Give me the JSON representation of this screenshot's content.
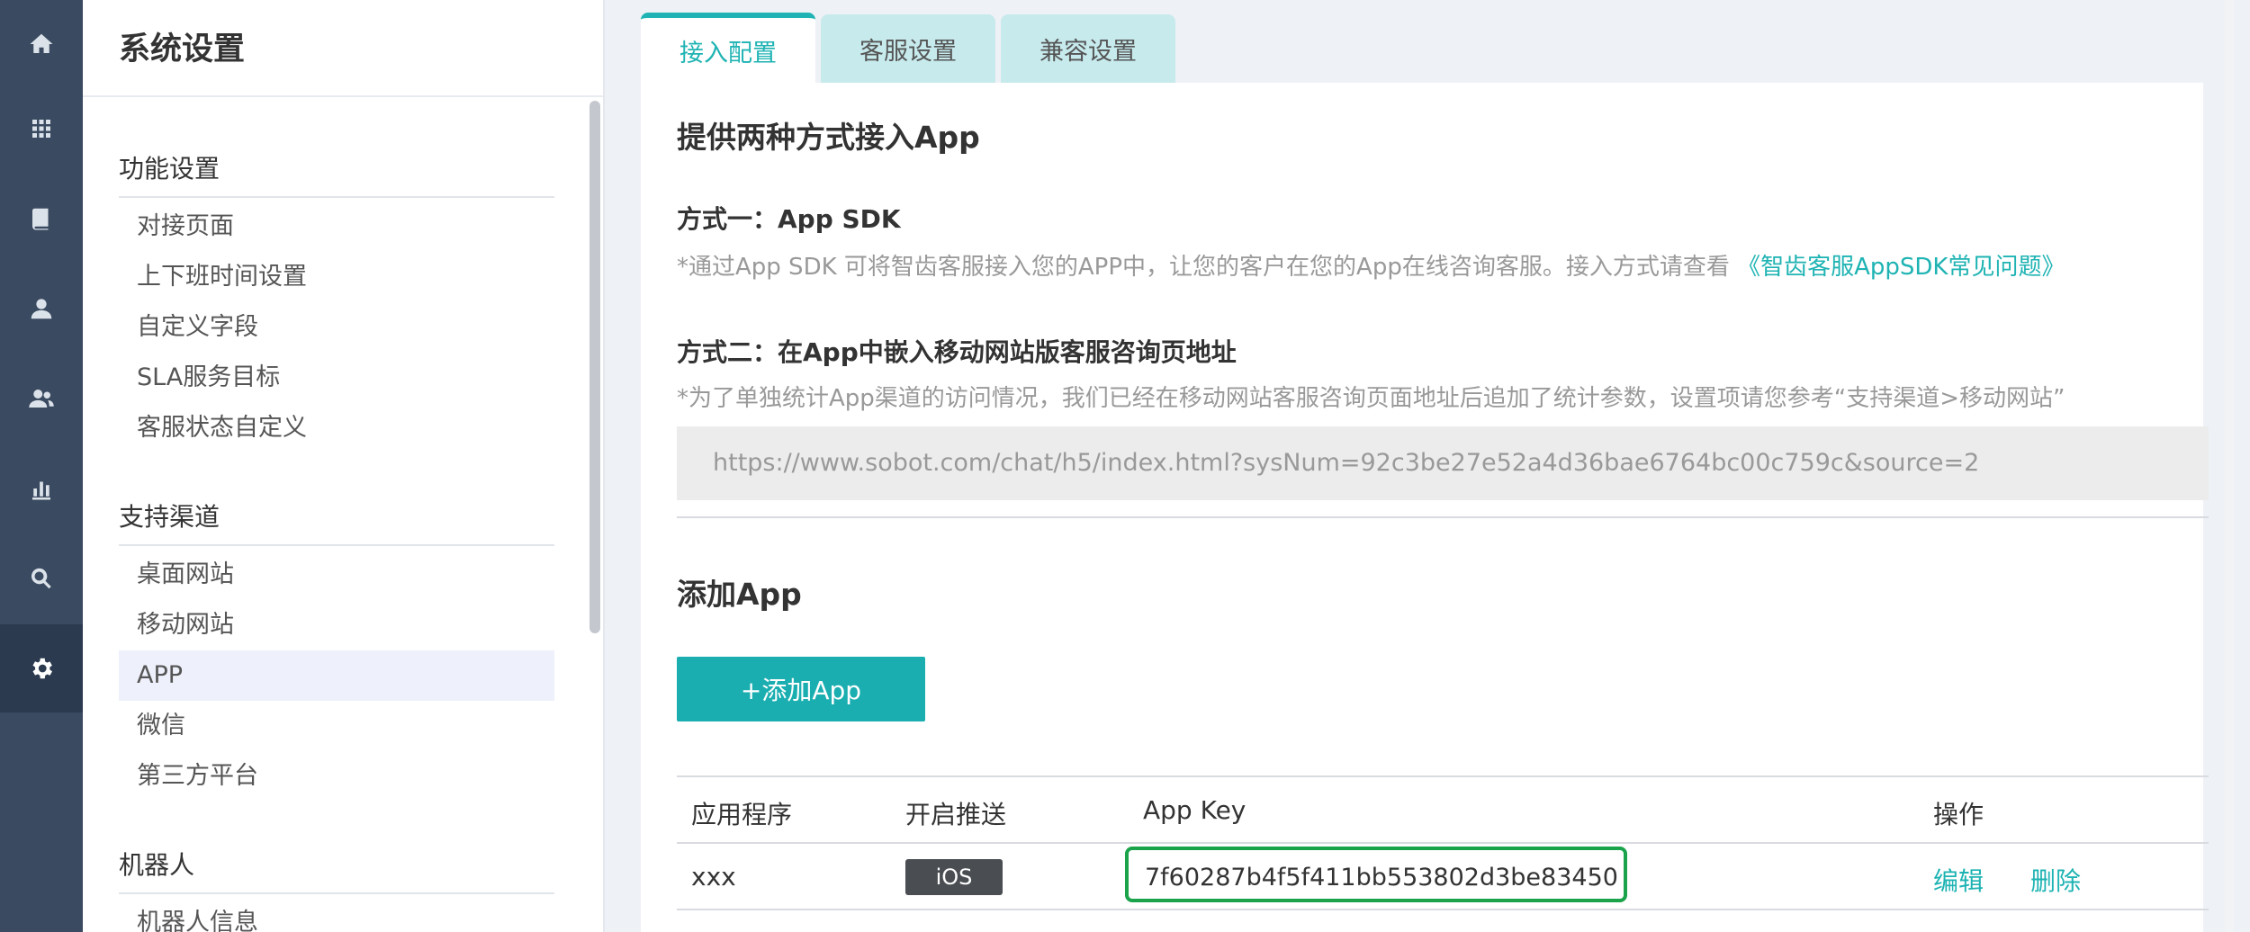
{
  "rail": {
    "icons": [
      "home-icon",
      "apps-grid-icon",
      "book-icon",
      "user-icon",
      "users-icon",
      "bar-chart-icon",
      "search-icon",
      "gear-icon"
    ]
  },
  "menu": {
    "title": "系统设置",
    "groups": [
      {
        "title": "功能设置",
        "items": [
          "对接页面",
          "上下班时间设置",
          "自定义字段",
          "SLA服务目标",
          "客服状态自定义"
        ]
      },
      {
        "title": "支持渠道",
        "items": [
          "桌面网站",
          "移动网站",
          "APP",
          "微信",
          "第三方平台"
        ]
      },
      {
        "title": "机器人",
        "items": [
          "机器人信息"
        ]
      }
    ],
    "active_item": "APP"
  },
  "tabs": [
    {
      "label": "接入配置",
      "active": true
    },
    {
      "label": "客服设置",
      "active": false
    },
    {
      "label": "兼容设置",
      "active": false
    }
  ],
  "main": {
    "heading": "提供两种方式接入App",
    "method1": {
      "title": "方式一：App SDK",
      "desc": "*通过App SDK 可将智齿客服接入您的APP中，让您的客户在您的App在线咨询客服。接入方式请查看",
      "link": "《智齿客服AppSDK常见问题》"
    },
    "method2": {
      "title": "方式二：在App中嵌入移动网站版客服咨询页地址",
      "desc": "*为了单独统计App渠道的访问情况，我们已经在移动网站客服咨询页面地址后追加了统计参数，设置项请您参考“支持渠道>移动网站”",
      "url": "https://www.sobot.com/chat/h5/index.html?sysNum=92c3be27e52a4d36bae6764bc00c759c&source=2"
    },
    "add_heading": "添加App",
    "add_button": "+添加App"
  },
  "table": {
    "headers": [
      "应用程序",
      "开启推送",
      "App Key",
      "操作"
    ],
    "rows": [
      {
        "app": "xxx",
        "push": "iOS",
        "key": "7f60287b4f5f411bb553802d3be83450",
        "edit": "编辑",
        "delete": "删除"
      }
    ]
  },
  "colors": {
    "accent": "#1fb3b3",
    "highlight": "#1aa34a",
    "rail": "#3a4a60"
  }
}
